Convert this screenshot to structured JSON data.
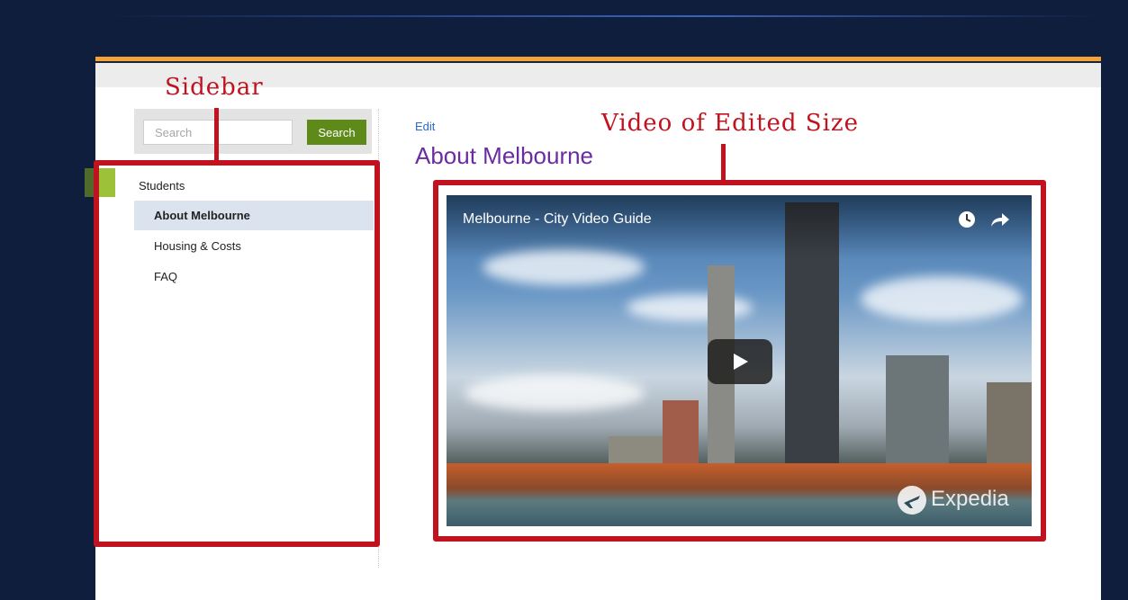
{
  "search": {
    "placeholder": "Search",
    "button_label": "Search"
  },
  "sidebar": {
    "items": [
      {
        "label": "Students"
      },
      {
        "label": "About Melbourne",
        "active": true
      },
      {
        "label": "Housing & Costs"
      },
      {
        "label": "FAQ"
      }
    ]
  },
  "main": {
    "edit_label": "Edit",
    "title": "About Melbourne",
    "video": {
      "title": "Melbourne - City Video Guide",
      "watermark": "Expedia",
      "icons": [
        "clock-icon",
        "share-icon",
        "play-icon"
      ]
    }
  },
  "annotations": {
    "sidebar_label": "Sidebar",
    "video_label": "Video of Edited Size",
    "color": "#c1121f"
  },
  "colors": {
    "background": "#0f1e3d",
    "accent": "#f1a33a",
    "search_button": "#5e8a1a",
    "title": "#6a2c9f",
    "link": "#2a6acb",
    "active_item": "#dbe3ef"
  }
}
